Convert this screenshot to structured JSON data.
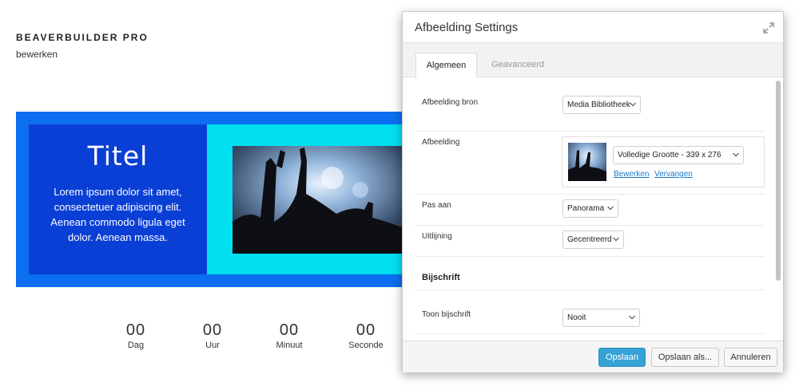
{
  "page": {
    "site_title": "BEAVERBUILDER PRO",
    "site_subtitle": "bewerken"
  },
  "hero": {
    "title": "Titel",
    "body": "Lorem ipsum dolor sit amet, consectetuer adipiscing elit. Aenean commodo ligula eget dolor. Aenean massa."
  },
  "countdown": [
    {
      "value": "00",
      "label": "Dag"
    },
    {
      "value": "00",
      "label": "Uur"
    },
    {
      "value": "00",
      "label": "Minuut"
    },
    {
      "value": "00",
      "label": "Seconde"
    }
  ],
  "modal": {
    "title": "Afbeelding Settings",
    "tabs": [
      {
        "label": "Algemeen",
        "active": true
      },
      {
        "label": "Geavanceerd",
        "active": false
      }
    ],
    "fields": {
      "source": {
        "label": "Afbeelding bron",
        "value": "Media Bibliotheek"
      },
      "image": {
        "label": "Afbeelding",
        "size_value": "Volledige Grootte - 339 x 276",
        "edit_link": "Bewerken",
        "replace_link": "Vervangen"
      },
      "crop": {
        "label": "Pas aan",
        "value": "Panorama"
      },
      "align": {
        "label": "Uitlijning",
        "value": "Gecentreerd"
      }
    },
    "caption_section": {
      "title": "Bijschrift",
      "show": {
        "label": "Toon bijschrift",
        "value": "Nooit"
      }
    },
    "buttons": {
      "save": "Opslaan",
      "save_as": "Opslaan als...",
      "cancel": "Annuleren"
    }
  },
  "colors": {
    "hero_outer": "#0c6ff0",
    "hero_left": "#0a3fd6",
    "hero_right": "#00e0f0",
    "primary_button": "#35a3d6",
    "link": "#1b79c8"
  }
}
